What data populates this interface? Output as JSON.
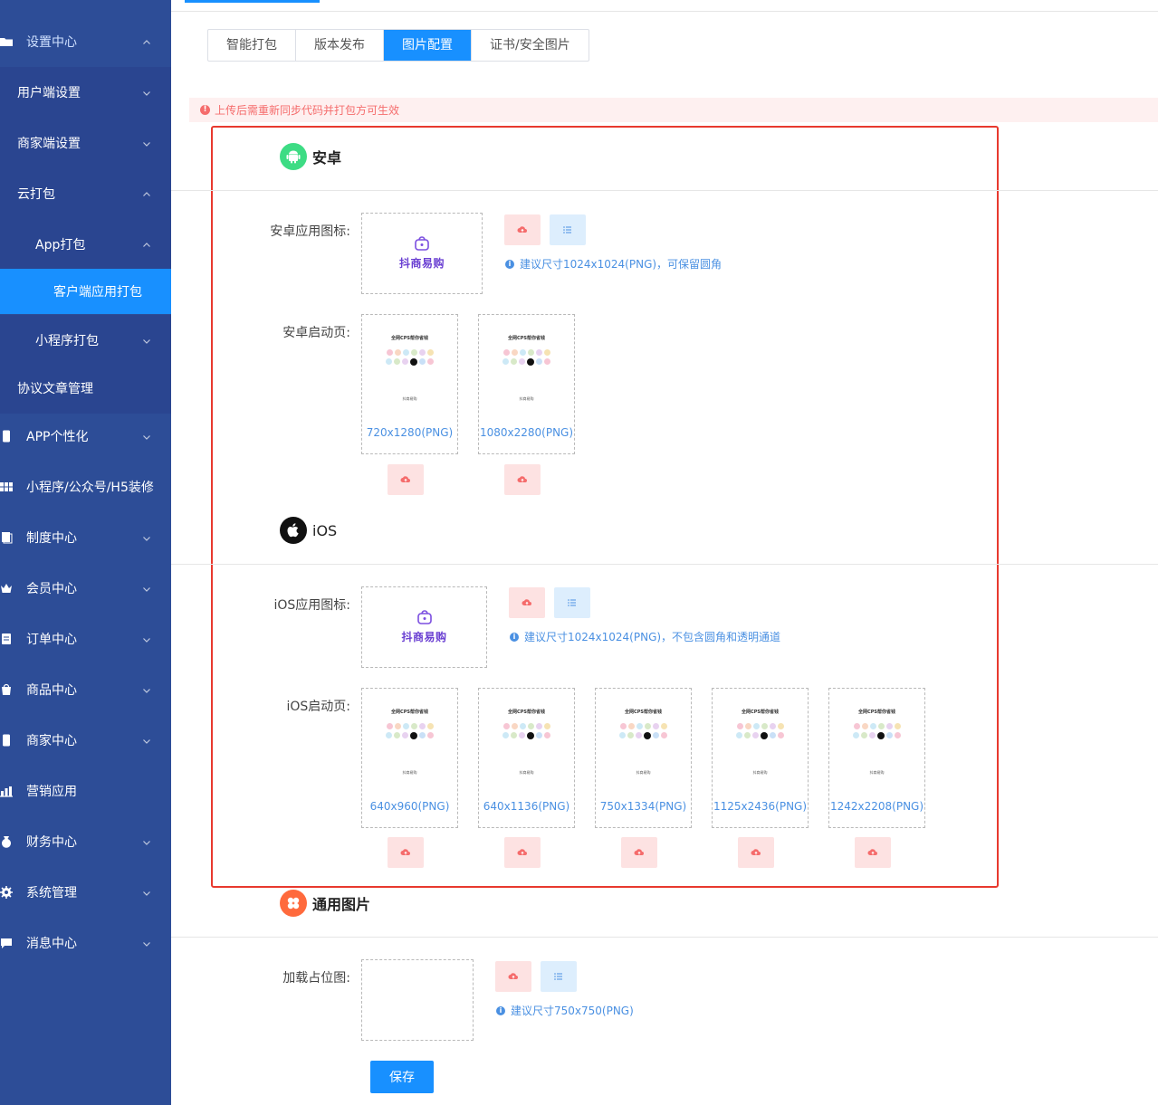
{
  "sidebar": {
    "items": [
      {
        "label": "设置中心",
        "icon": "folder-icon",
        "expanded": true
      },
      {
        "label": "用户端设置",
        "icon": "",
        "expanded": false
      },
      {
        "label": "商家端设置",
        "icon": "",
        "expanded": false
      },
      {
        "label": "云打包",
        "icon": "",
        "expanded": true
      },
      {
        "label": "App打包",
        "icon": "",
        "expanded": true
      },
      {
        "label": "客户端应用打包",
        "icon": "",
        "active": true
      },
      {
        "label": "小程序打包",
        "icon": "",
        "expanded": false
      },
      {
        "label": "协议文章管理",
        "icon": ""
      },
      {
        "label": "APP个性化",
        "icon": "phone-icon",
        "expanded": false
      },
      {
        "label": "小程序/公众号/H5装修",
        "icon": "grid-icon"
      },
      {
        "label": "制度中心",
        "icon": "document-icon",
        "expanded": false
      },
      {
        "label": "会员中心",
        "icon": "crown-icon",
        "expanded": false
      },
      {
        "label": "订单中心",
        "icon": "clipboard-icon",
        "expanded": false
      },
      {
        "label": "商品中心",
        "icon": "bag-icon",
        "expanded": false
      },
      {
        "label": "商家中心",
        "icon": "phone-icon",
        "expanded": false
      },
      {
        "label": "营销应用",
        "icon": "chart-icon"
      },
      {
        "label": "财务中心",
        "icon": "money-bag-icon",
        "expanded": false
      },
      {
        "label": "系统管理",
        "icon": "gear-icon",
        "expanded": false
      },
      {
        "label": "消息中心",
        "icon": "chat-icon",
        "expanded": false
      }
    ]
  },
  "tabs": [
    {
      "label": "智能打包"
    },
    {
      "label": "版本发布"
    },
    {
      "label": "图片配置",
      "active": true
    },
    {
      "label": "证书/安全图片"
    }
  ],
  "alert": {
    "text": "上传后需重新同步代码并打包方可生效"
  },
  "android": {
    "title": "安卓",
    "icon_label": "安卓应用图标:",
    "icon_hint": "建议尺寸1024x1024(PNG)，可保留圆角",
    "splash_label": "安卓启动页:",
    "splash_sizes": [
      "720x1280(PNG)",
      "1080x2280(PNG)"
    ]
  },
  "ios": {
    "title": "iOS",
    "icon_label": "iOS应用图标:",
    "icon_hint": "建议尺寸1024x1024(PNG)，不包含圆角和透明通道",
    "splash_label": "iOS启动页:",
    "splash_sizes": [
      "640x960(PNG)",
      "640x1136(PNG)",
      "750x1334(PNG)",
      "1125x2436(PNG)",
      "1242x2208(PNG)"
    ]
  },
  "common": {
    "title": "通用图片",
    "placeholder_label": "加载占位图:",
    "placeholder_hint": "建议尺寸750x750(PNG)"
  },
  "app_logo": {
    "name": "抖商易购"
  },
  "splash_preview": {
    "title": "全网CPS帮你省钱",
    "brand": "抖商易购"
  },
  "save_label": "保存",
  "colors": {
    "sidebar": "#2d4d97",
    "primary": "#1890ff",
    "danger": "#f56c6c",
    "highlight": "#e8392e"
  }
}
